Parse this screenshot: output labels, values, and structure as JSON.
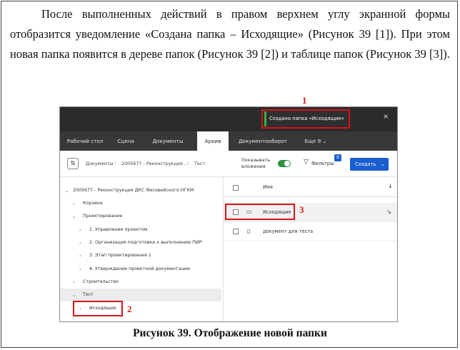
{
  "document": {
    "paragraph": "После выполненных действий в правом верхнем углу экранной формы отобразится уведомление «Создана папка – Исходящие» (Рисунок 39 [1]). При этом новая папка появится в дереве папок (Рисунок 39 [2]) и таблице папок (Рисунок 39 [3]).",
    "caption": "Рисунок 39. Отображение новой папки"
  },
  "screenshot": {
    "notification": {
      "text": "Создана папка «Исходящие»",
      "close": "×",
      "accent_color": "#33b04a"
    },
    "tabs": [
      {
        "label": "Рабочий стол"
      },
      {
        "label": "Сцена"
      },
      {
        "label": "Документы"
      },
      {
        "label": "Архив"
      },
      {
        "label": "Документооборот"
      },
      {
        "label": "Еще 9 ⌄"
      }
    ],
    "active_tab": "Архив",
    "breadcrumb": [
      "Документы",
      "2005677 - Реконструкция ...",
      "Тест"
    ],
    "toggle": {
      "label": "Показывать вложения",
      "on": true
    },
    "filters": {
      "label": "Фильтры",
      "badge": "0"
    },
    "create_button": "Создать",
    "tree": [
      {
        "label": "2005677 - Реконструкция ДКС Ямсовейского НГКМ",
        "level": 0,
        "expanded": true
      },
      {
        "label": "Корзина",
        "level": 1,
        "expanded": false
      },
      {
        "label": "Проектирование",
        "level": 1,
        "expanded": true
      },
      {
        "label": "1. Управление проектом",
        "level": 2,
        "expanded": false
      },
      {
        "label": "2. Организация подготовки к выполнению ПИР",
        "level": 2,
        "expanded": false
      },
      {
        "label": "3. Этап проектирования 1",
        "level": 2,
        "expanded": false
      },
      {
        "label": "4. Утверждение проектной документации",
        "level": 2,
        "expanded": false
      },
      {
        "label": "Строительство",
        "level": 1,
        "expanded": false
      },
      {
        "label": "Тест",
        "level": 1,
        "expanded": true,
        "selected": true
      },
      {
        "label": "Исходящие",
        "level": 2,
        "expanded": false
      }
    ],
    "list": {
      "column_header": "Имя",
      "rows": [
        {
          "label": "Исходящие",
          "type": "folder"
        },
        {
          "label": "документ для теста",
          "type": "document"
        }
      ]
    },
    "markers": [
      "1",
      "2",
      "3"
    ],
    "highlight_color": "#d41616",
    "brand_color": "#1a5ed0"
  }
}
